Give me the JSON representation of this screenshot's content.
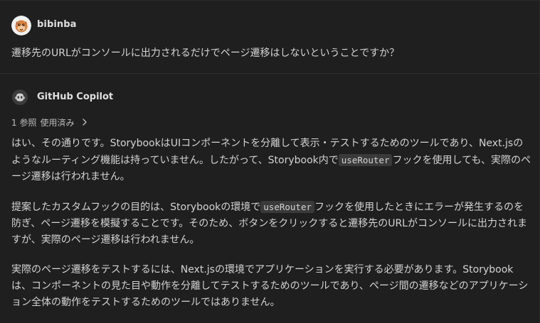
{
  "request": {
    "username": "bibinba",
    "message": "遷移先のURLがコンソールに出力されるだけでページ遷移はしないということですか？"
  },
  "response": {
    "author": "GitHub Copilot",
    "references": {
      "count": "1 参照",
      "label": "使用済み"
    },
    "paragraphs": [
      {
        "segments": [
          "はい、その通りです。StorybookはUIコンポーネントを分離して表示・テストするためのツールであり、Next.jsのようなルーティング機能は持っていません。したがって、Storybook内で",
          "useRouter",
          "フックを使用しても、実際のページ遷移は行われません。"
        ]
      },
      {
        "segments": [
          "提案したカスタムフックの目的は、Storybookの環境で",
          "useRouter",
          "フックを使用したときにエラーが発生するのを防ぎ、ページ遷移を模擬することです。そのため、ボタンをクリックすると遷移先のURLがコンソールに出力されますが、実際のページ遷移は行われません。"
        ]
      },
      {
        "segments": [
          "実際のページ遷移をテストするには、Next.jsの環境でアプリケーションを実行する必要があります。Storybookは、コンポーネントの見た目や動作を分離してテストするためのツールであり、ページ間の遷移などのアプリケーション全体の動作をテストするためのツールではありません。"
        ]
      }
    ]
  },
  "colors": {
    "background": "#1f1f1f",
    "text": "#d4d4d4",
    "code_bg": "#3a3a3a",
    "avatar_bg": "#f0f0f0",
    "avatar_face": "#d9823f"
  },
  "icons": {
    "user_avatar": "user-avatar-icon",
    "copilot": "copilot-icon",
    "references_chevron": "chevron-right-icon"
  }
}
